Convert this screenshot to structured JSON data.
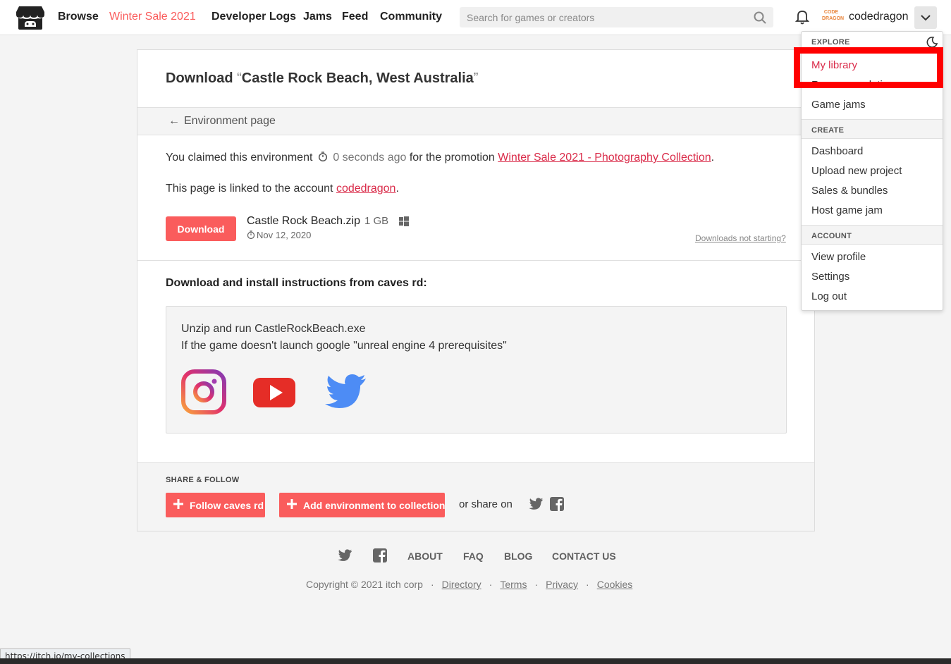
{
  "header": {
    "nav": [
      "Browse",
      "Winter Sale 2021",
      "Developer Logs",
      "Jams",
      "Feed",
      "Community"
    ],
    "search_placeholder": "Search for games or creators",
    "avatar_text": "CODE DRAGON",
    "username": "codedragon"
  },
  "page": {
    "title_prefix": "Download ",
    "title_open_quote": "“",
    "title_name": "Castle Rock Beach, West Australia",
    "title_close_quote": "”",
    "back_link": "Environment page",
    "claim_text": "You claimed this environment",
    "claim_time": "0 seconds ago",
    "claim_mid": "for the promotion",
    "promotion": "Winter Sale 2021 - Photography Collection",
    "linked_text": "This page is linked to the account",
    "account": "codedragon",
    "download_label": "Download",
    "file_name": "Castle Rock Beach.zip",
    "file_size": "1 GB",
    "file_date": "Nov 12, 2020",
    "not_starting": "Downloads not starting?",
    "instructions_title": "Download and install instructions from caves rd:",
    "instructions": [
      "Unzip and run CastleRockBeach.exe",
      "If the game doesn't launch google \"unreal engine 4 prerequisites\""
    ],
    "share_title": "SHARE & FOLLOW",
    "follow_label": "Follow caves rd",
    "add_collection_label": "Add environment to collection",
    "share_on": "or share on"
  },
  "footer": {
    "links": [
      "ABOUT",
      "FAQ",
      "BLOG",
      "CONTACT US"
    ],
    "copyright": "Copyright © 2021 itch corp",
    "sub_links": [
      "Directory",
      "Terms",
      "Privacy",
      "Cookies"
    ]
  },
  "dropdown": {
    "explore_header": "EXPLORE",
    "explore": [
      "My library",
      "Recommendations",
      "Game jams"
    ],
    "create_header": "CREATE",
    "create": [
      "Dashboard",
      "Upload new project",
      "Sales & bundles",
      "Host game jam"
    ],
    "account_header": "ACCOUNT",
    "account": [
      "View profile",
      "Settings",
      "Log out"
    ]
  },
  "status_url": "https://itch.io/my-collections",
  "colors": {
    "accent": "#fa5c5c",
    "link": "#da2c4a",
    "highlight_box": "#ff0000"
  }
}
